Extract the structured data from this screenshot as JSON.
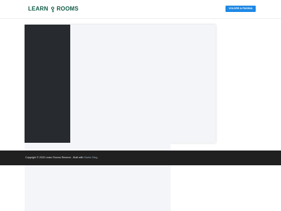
{
  "header": {
    "logo_left": "LEARN",
    "logo_right": "ROOMS",
    "back_button_label": "VOLVER A PAGINA"
  },
  "footer": {
    "copyright": "Copyright © 2020 Learn Rooms Reserve - Built with",
    "link_text": "Starter Blog",
    "end": "."
  },
  "colors": {
    "brand_green": "#0f5a45",
    "accent_blue": "#1e88e5",
    "sidebar_dark": "#272a2f",
    "footer_dark": "#202020"
  },
  "icons": {
    "logo_mark": "key-icon"
  }
}
